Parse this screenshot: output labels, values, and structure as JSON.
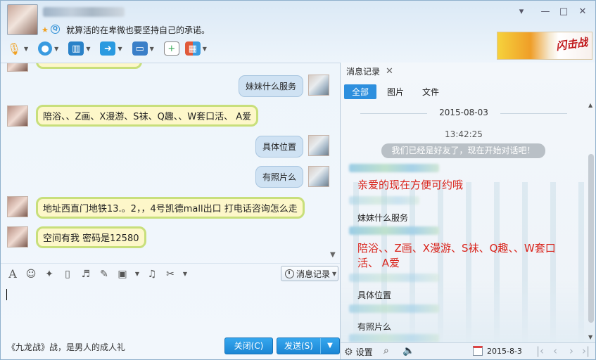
{
  "header": {
    "signature": "就算活的在卑微也要坚持自己的承诺。",
    "window_buttons": [
      "▾",
      "—",
      "□",
      "✕"
    ]
  },
  "top_toolbar": {
    "items": [
      {
        "icon": "microphone-icon",
        "color": "#f0a020"
      },
      {
        "icon": "webcam-icon",
        "color": "#3a9be0"
      },
      {
        "icon": "screen-share-icon",
        "color": "#2a82c8"
      },
      {
        "icon": "file-transfer-icon",
        "color": "#2a9ae0"
      },
      {
        "icon": "remote-desktop-icon",
        "color": "#3a7fc8"
      },
      {
        "icon": "new-discussion-icon",
        "color": "#3aaa5a"
      },
      {
        "icon": "apps-grid-icon",
        "color": "#e05a3a"
      }
    ]
  },
  "ad": {
    "text": "闪击战"
  },
  "chat": {
    "messages": [
      {
        "from": "me",
        "text": "妹妹什么服务"
      },
      {
        "from": "them",
        "text": "陪浴、、Z画、X漫游、S袜、Q趣、、W套口活、    A爱"
      },
      {
        "from": "me",
        "text": "具体位置"
      },
      {
        "from": "me",
        "text": "有照片么"
      },
      {
        "from": "them",
        "text": "地址西直门地铁13.。2，，4号凯德mall出口 打电话咨询怎么走"
      },
      {
        "from": "them",
        "text": "空间有我     密码是12580"
      }
    ]
  },
  "input_toolbar": {
    "icons": [
      "font-icon",
      "emoji-icon",
      "magic-wand-icon",
      "gif-icon",
      "voice-icon",
      "edit-icon",
      "image-icon",
      "music-icon",
      "screenshot-icon"
    ],
    "history_label": "消息记录"
  },
  "footer": {
    "ad_text": "《九龙战》战，是男人的成人礼",
    "close_label": "关闭(C)",
    "send_label": "发送(S)"
  },
  "history": {
    "tab_label": "消息记录",
    "filters": [
      "全部",
      "图片",
      "文件"
    ],
    "active_filter": "全部",
    "date": "2015-08-03",
    "time": "13:42:25",
    "system_message": "我们已经是好友了，现在开始对话吧！",
    "entries": [
      {
        "text": "亲爱的现在方便可约哦",
        "style": "red"
      },
      {
        "text": "妹妹什么服务",
        "style": "normal"
      },
      {
        "text": "陪浴、、Z画、X漫游、S袜、Q趣、、W套口活、    A爱",
        "style": "red"
      },
      {
        "text": "具体位置",
        "style": "normal"
      },
      {
        "text": "有照片么",
        "style": "normal"
      }
    ],
    "bottom": {
      "settings_label": "设置",
      "date_value": "2015-8-3"
    }
  }
}
